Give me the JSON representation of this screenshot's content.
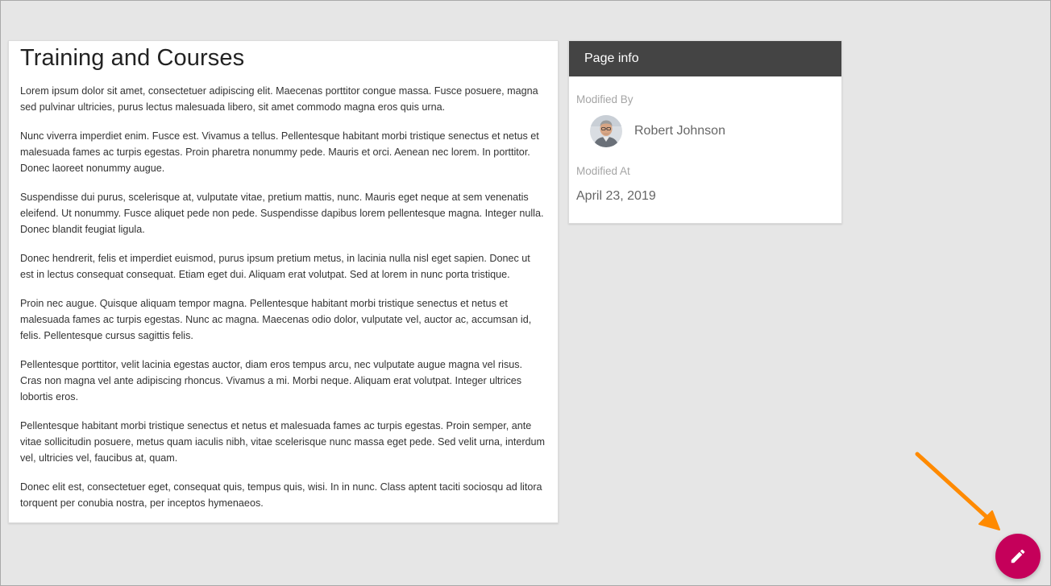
{
  "main": {
    "title": "Training and Courses",
    "paragraphs": [
      "Lorem ipsum dolor sit amet, consectetuer adipiscing elit. Maecenas porttitor congue massa. Fusce posuere, magna sed pulvinar ultricies, purus lectus malesuada libero, sit amet commodo magna eros quis urna.",
      "Nunc viverra imperdiet enim. Fusce est. Vivamus a tellus. Pellentesque habitant morbi tristique senectus et netus et malesuada fames ac turpis egestas. Proin pharetra nonummy pede. Mauris et orci. Aenean nec lorem. In porttitor. Donec laoreet nonummy augue.",
      "Suspendisse dui purus, scelerisque at, vulputate vitae, pretium mattis, nunc. Mauris eget neque at sem venenatis eleifend. Ut nonummy. Fusce aliquet pede non pede. Suspendisse dapibus lorem pellentesque magna. Integer nulla. Donec blandit feugiat ligula.",
      "Donec hendrerit, felis et imperdiet euismod, purus ipsum pretium metus, in lacinia nulla nisl eget sapien. Donec ut est in lectus consequat consequat. Etiam eget dui. Aliquam erat volutpat. Sed at lorem in nunc porta tristique.",
      "Proin nec augue. Quisque aliquam tempor magna. Pellentesque habitant morbi tristique senectus et netus et malesuada fames ac turpis egestas. Nunc ac magna. Maecenas odio dolor, vulputate vel, auctor ac, accumsan id, felis. Pellentesque cursus sagittis felis.",
      "Pellentesque porttitor, velit lacinia egestas auctor, diam eros tempus arcu, nec vulputate augue magna vel risus. Cras non magna vel ante adipiscing rhoncus. Vivamus a mi. Morbi neque. Aliquam erat volutpat. Integer ultrices lobortis eros.",
      "Pellentesque habitant morbi tristique senectus et netus et malesuada fames ac turpis egestas. Proin semper, ante vitae sollicitudin posuere, metus quam iaculis nibh, vitae scelerisque nunc massa eget pede. Sed velit urna, interdum vel, ultricies vel, faucibus at, quam.",
      "Donec elit est, consectetuer eget, consequat quis, tempus quis, wisi. In in nunc. Class aptent taciti sociosqu ad litora torquent per conubia nostra, per inceptos hymenaeos."
    ]
  },
  "page_info": {
    "header": "Page info",
    "modified_by_label": "Modified By",
    "author_name": "Robert Johnson",
    "modified_at_label": "Modified At",
    "modified_date": "April 23, 2019"
  },
  "icons": {
    "edit_button": "pencil-icon",
    "avatar": "user-avatar",
    "annotation": "arrow-icon"
  },
  "colors": {
    "background": "#e6e6e6",
    "header_bg": "#444444",
    "fab": "#c5005a",
    "annotation_arrow": "#ff8a00"
  }
}
